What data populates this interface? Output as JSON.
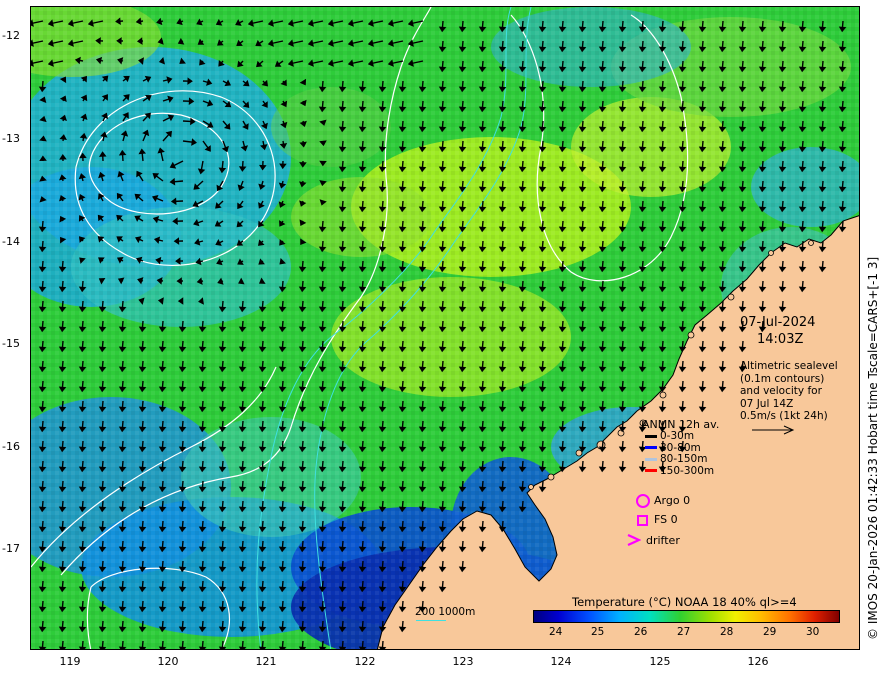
{
  "map": {
    "lat_labels": [
      "-12",
      "-13",
      "-14",
      "-15",
      "-16",
      "-17"
    ],
    "lon_labels": [
      "119",
      "120",
      "121",
      "122",
      "123",
      "124",
      "125",
      "126"
    ],
    "date": "07-Jul-2024",
    "time": "14:03Z",
    "info_lines": [
      "Altimetric sealevel",
      "(0.1m contours)",
      "and velocity for",
      "07 Jul 14Z",
      "0.5m/s (1kt 24h)"
    ],
    "legend_title": "ANMN 12h av.",
    "depth_legend": [
      {
        "label": "0-30m",
        "color": "#000000"
      },
      {
        "label": "30-80m",
        "color": "#0000ff"
      },
      {
        "label": "80-150m",
        "color": "#b0c4de"
      },
      {
        "label": "150-300m",
        "color": "#ff0000"
      }
    ],
    "argo_label": "Argo 0",
    "fs_label": "FS 0",
    "drifter_label": "drifter",
    "isobath_label": "200  1000m",
    "colorbar_title": "Temperature (°C) NOAA 18 40% ql>=4",
    "colorbar_ticks": [
      "24",
      "25",
      "26",
      "27",
      "28",
      "29",
      "30"
    ],
    "side_label": "© IMOS 20-Jan-2026 01:42:33 Hobart time Tscale=CARS+[-1 3]",
    "colors": {
      "land": "#f8c89a",
      "magenta": "#ff00ff",
      "contour": "#ffffff",
      "isobath": "#40e0e0"
    }
  }
}
